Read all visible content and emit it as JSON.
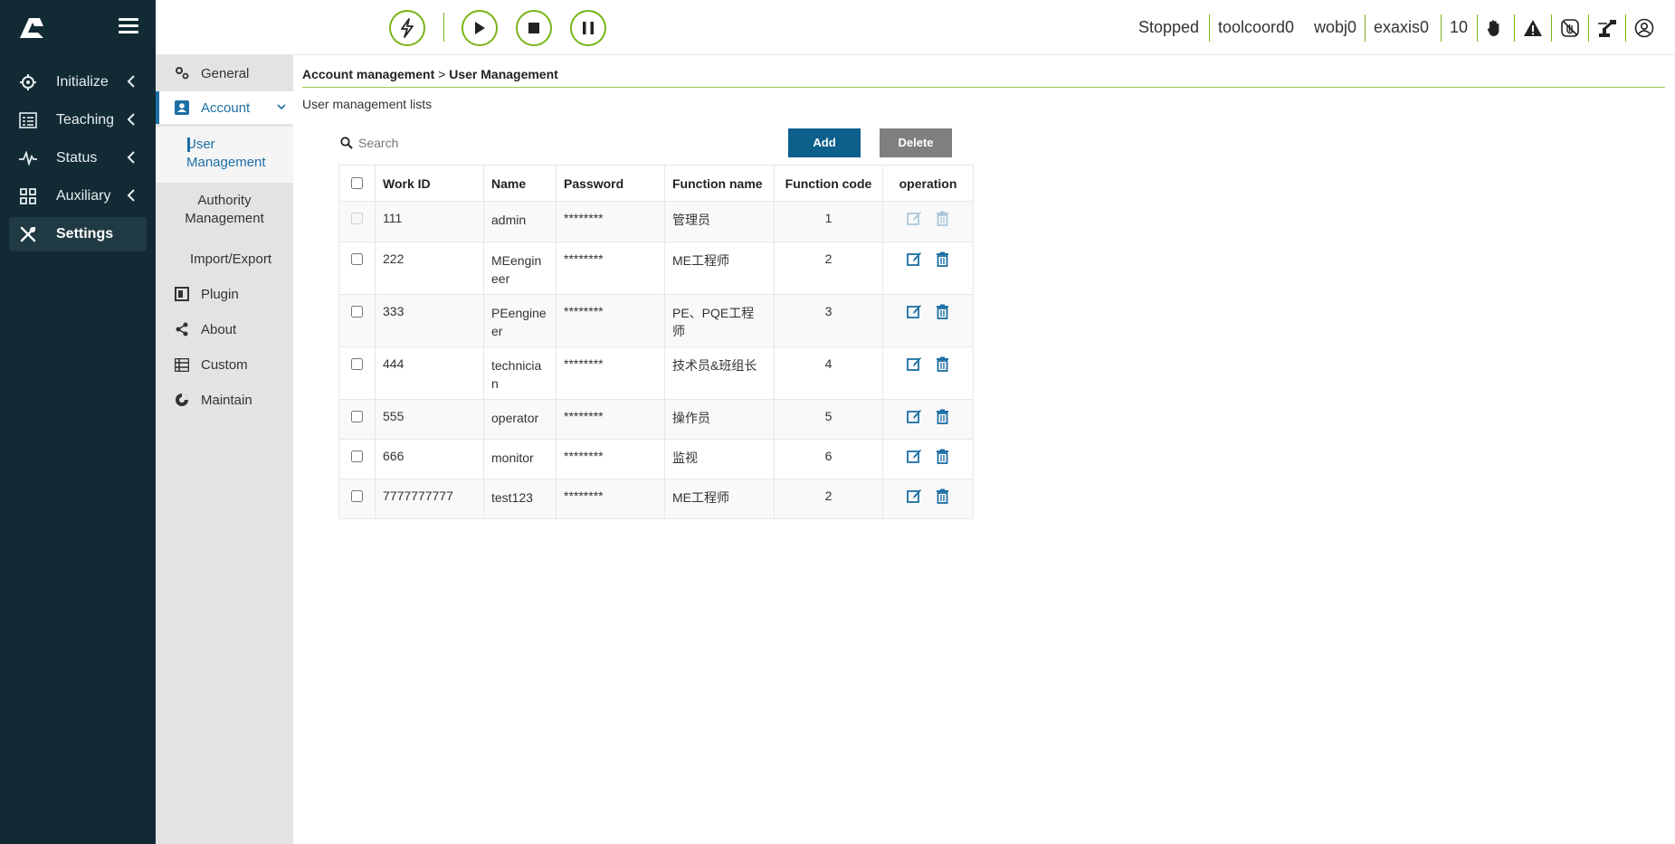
{
  "leftnav": {
    "items": [
      {
        "label": "Initialize"
      },
      {
        "label": "Teaching"
      },
      {
        "label": "Status"
      },
      {
        "label": "Auxiliary"
      },
      {
        "label": "Settings"
      }
    ]
  },
  "subnav": {
    "general": "General",
    "account": "Account",
    "user_management": "User Management",
    "authority_management": "Authority Management",
    "import_export": "Import/Export",
    "plugin": "Plugin",
    "about": "About",
    "custom": "Custom",
    "maintain": "Maintain"
  },
  "topbar": {
    "state": "Stopped",
    "toolcoord": "toolcoord0",
    "wobj": "wobj0",
    "exaxis": "exaxis0",
    "speed": "10"
  },
  "content": {
    "breadcrumb_parent": "Account management",
    "breadcrumb_sep": " > ",
    "breadcrumb_current": "User Management",
    "list_title": "User management lists",
    "search_placeholder": "Search",
    "add_label": "Add",
    "delete_label": "Delete"
  },
  "table": {
    "headers": [
      "Work ID",
      "Name",
      "Password",
      "Function name",
      "Function code",
      "operation"
    ],
    "rows": [
      {
        "id": "111",
        "name": "admin",
        "password": "********",
        "function_name": "管理员",
        "function_code": "1"
      },
      {
        "id": "222",
        "name": "MEengineer",
        "password": "********",
        "function_name": "ME工程师",
        "function_code": "2"
      },
      {
        "id": "333",
        "name": "PEengineer",
        "password": "********",
        "function_name": "PE、PQE工程师",
        "function_code": "3"
      },
      {
        "id": "444",
        "name": "technician",
        "password": "********",
        "function_name": "技术员&班组长",
        "function_code": "4"
      },
      {
        "id": "555",
        "name": "operator",
        "password": "********",
        "function_name": "操作员",
        "function_code": "5"
      },
      {
        "id": "666",
        "name": "monitor",
        "password": "********",
        "function_name": "监视",
        "function_code": "6"
      },
      {
        "id": "7777777777",
        "name": "test123",
        "password": "********",
        "function_name": "ME工程师",
        "function_code": "2"
      }
    ]
  },
  "colors": {
    "nav_bg": "#112a33",
    "accent_green": "#7ab317",
    "primary_blue": "#0d5f8c",
    "link_blue": "#1c6ea4",
    "delete_gray": "#7f7f7f"
  }
}
